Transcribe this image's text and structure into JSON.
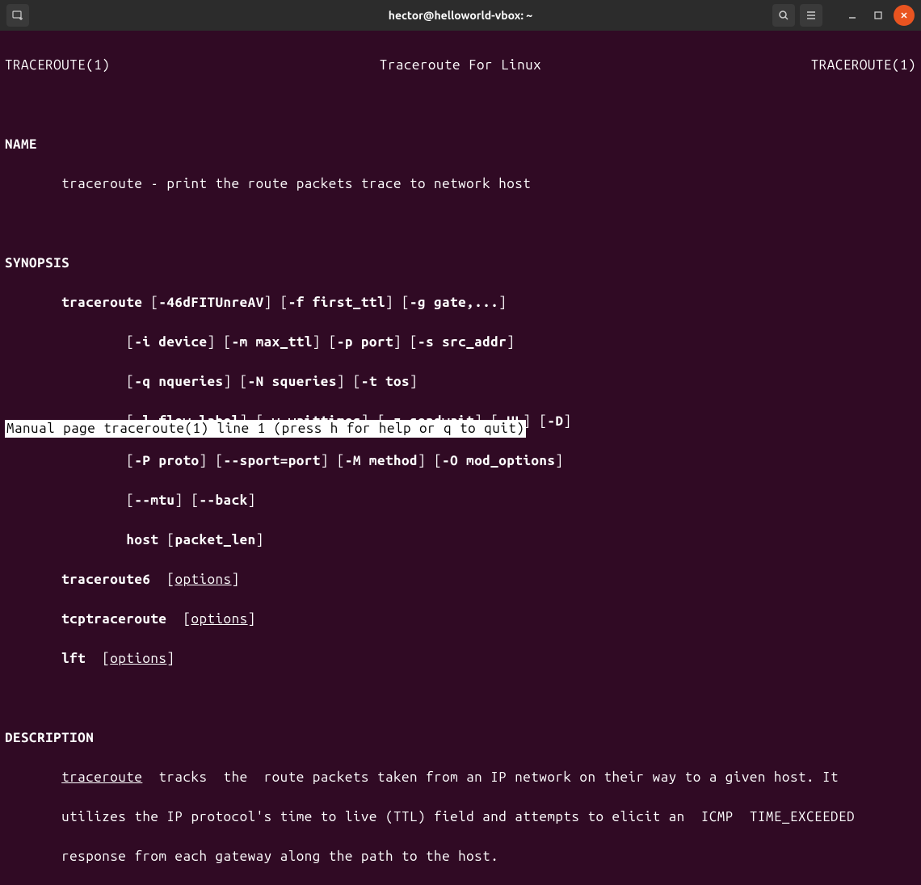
{
  "titlebar": {
    "title": "hector@helloworld-vbox: ~"
  },
  "manpage": {
    "header_left": "TRACEROUTE(1)",
    "header_center": "Traceroute For Linux",
    "header_right": "TRACEROUTE(1)",
    "section_name": "NAME",
    "name_text": "       traceroute - print the route packets trace to network host",
    "section_synopsis": "SYNOPSIS",
    "syn_line1_a": "       traceroute",
    "syn_line1_b": " [",
    "syn_line1_c": "-46dFITUnreAV",
    "syn_line1_d": "] [",
    "syn_line1_e": "-f first_ttl",
    "syn_line1_f": "] [",
    "syn_line1_g": "-g gate,...",
    "syn_line1_h": "]",
    "syn_line2_a": "               [",
    "syn_line2_b": "-i device",
    "syn_line2_c": "] [",
    "syn_line2_d": "-m max_ttl",
    "syn_line2_e": "] [",
    "syn_line2_f": "-p port",
    "syn_line2_g": "] [",
    "syn_line2_h": "-s src_addr",
    "syn_line2_i": "]",
    "syn_line3_a": "               [",
    "syn_line3_b": "-q nqueries",
    "syn_line3_c": "] [",
    "syn_line3_d": "-N squeries",
    "syn_line3_e": "] [",
    "syn_line3_f": "-t tos",
    "syn_line3_g": "]",
    "syn_line4_a": "               [",
    "syn_line4_b": "-l flow_label",
    "syn_line4_c": "] [",
    "syn_line4_d": "-w waittimes",
    "syn_line4_e": "] [",
    "syn_line4_f": "-z sendwait",
    "syn_line4_g": "] [",
    "syn_line4_h": "-UL",
    "syn_line4_i": "] [",
    "syn_line4_j": "-D",
    "syn_line4_k": "]",
    "syn_line5_a": "               [",
    "syn_line5_b": "-P proto",
    "syn_line5_c": "] [",
    "syn_line5_d": "--sport=port",
    "syn_line5_e": "] [",
    "syn_line5_f": "-M method",
    "syn_line5_g": "] [",
    "syn_line5_h": "-O mod_options",
    "syn_line5_i": "]",
    "syn_line6_a": "               [",
    "syn_line6_b": "--mtu",
    "syn_line6_c": "] [",
    "syn_line6_d": "--back",
    "syn_line6_e": "]",
    "syn_line7_a": "               ",
    "syn_line7_b": "host",
    "syn_line7_c": " [",
    "syn_line7_d": "packet_len",
    "syn_line7_e": "]",
    "syn_line8_a": "       traceroute6",
    "syn_line8_b": "  [",
    "syn_line8_c": "options",
    "syn_line8_d": "]",
    "syn_line9_a": "       tcptraceroute",
    "syn_line9_b": "  [",
    "syn_line9_c": "options",
    "syn_line9_d": "]",
    "syn_line10_a": "       lft",
    "syn_line10_b": "  [",
    "syn_line10_c": "options",
    "syn_line10_d": "]",
    "section_description": "DESCRIPTION",
    "desc_line1_a": "       ",
    "desc_line1_b": "traceroute",
    "desc_line1_c": "  tracks  the  route packets taken from an IP network on their way to a given host. It",
    "desc_line2": "       utilizes the IP protocol's time to live (TTL) field and attempts to elicit an  ICMP  TIME_EXCEEDED",
    "desc_line3": "       response from each gateway along the path to the host.",
    "status": " Manual page traceroute(1) line 1 (press h for help or q to quit)"
  }
}
